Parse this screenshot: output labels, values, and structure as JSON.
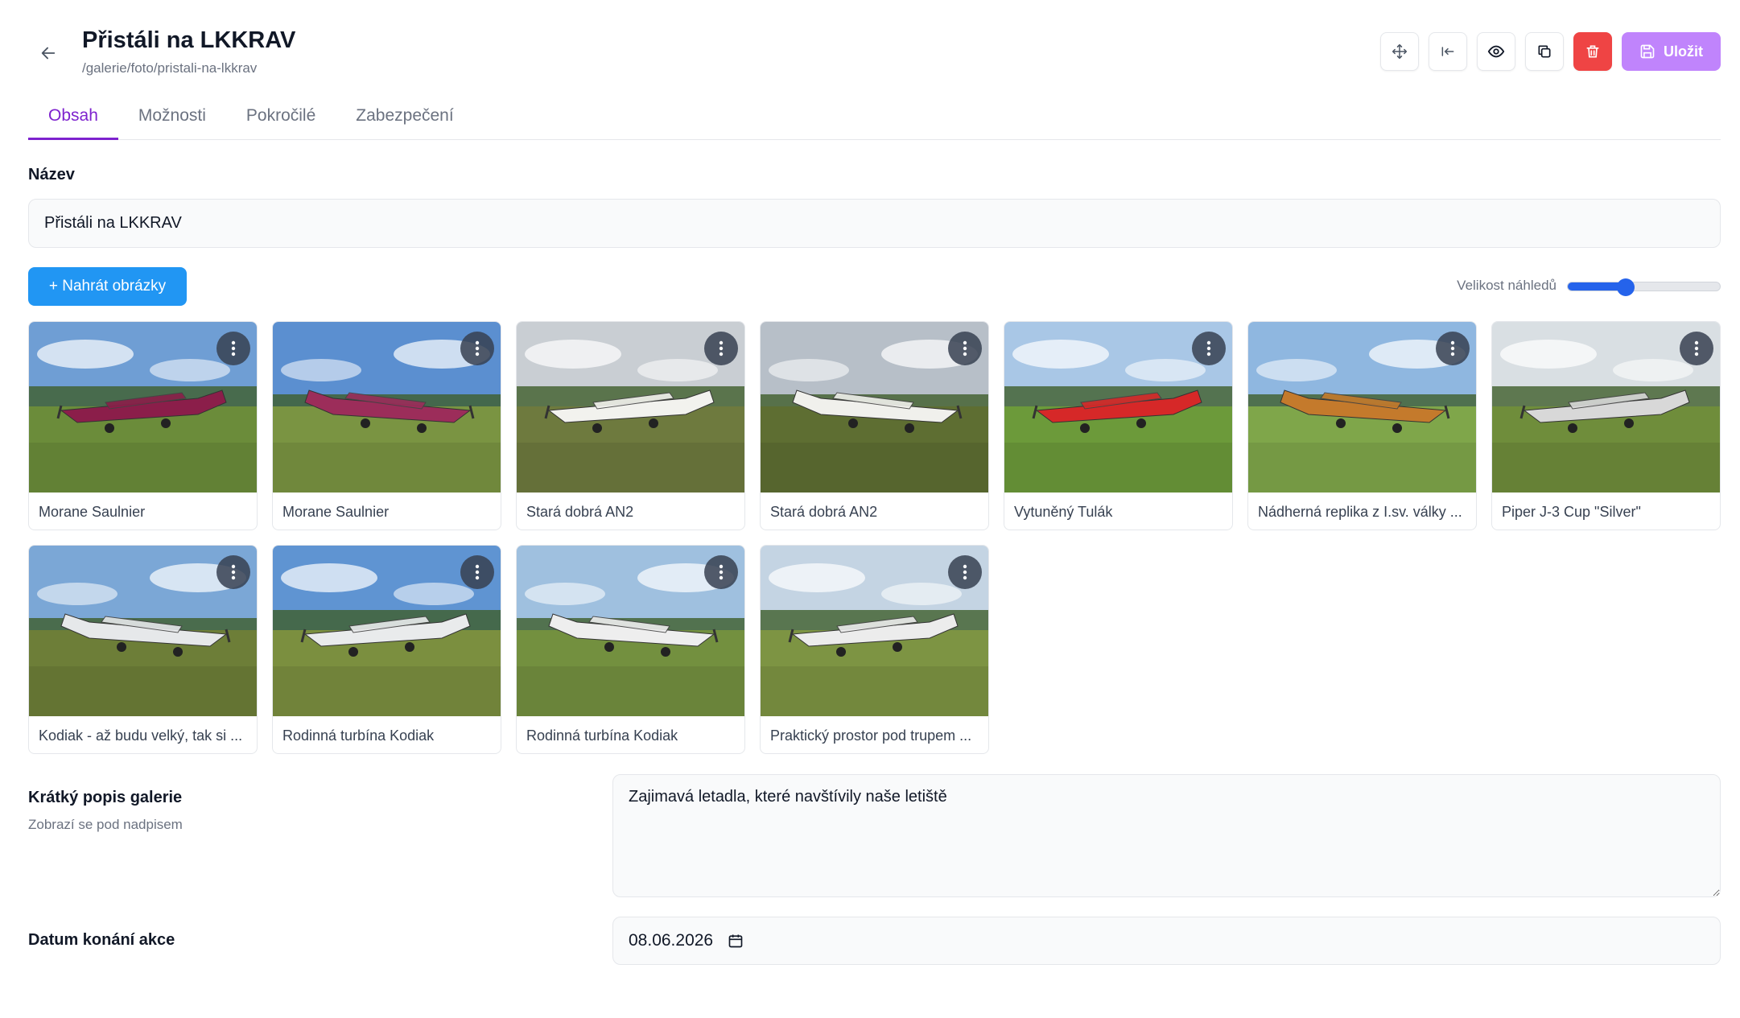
{
  "header": {
    "title": "Přistáli na LKKRAV",
    "path": "/galerie/foto/pristali-na-lkkrav",
    "save_label": "Uložit"
  },
  "tabs": [
    {
      "label": "Obsah",
      "active": true
    },
    {
      "label": "Možnosti",
      "active": false
    },
    {
      "label": "Pokročilé",
      "active": false
    },
    {
      "label": "Zabezpečení",
      "active": false
    }
  ],
  "form": {
    "name_label": "Název",
    "name_value": "Přistáli na LKKRAV",
    "upload_label": "+ Nahrát obrázky",
    "thumb_size_label": "Velikost náhledů",
    "thumb_size_value": 0.38,
    "description_label": "Krátký popis galerie",
    "description_hint": "Zobrazí se pod nadpisem",
    "description_value": "Zajimavá letadla, které navštívily naše letiště",
    "date_label": "Datum konání akce",
    "date_value": "08.06.2026"
  },
  "images": [
    {
      "caption": "Morane Saulnier",
      "sky": "#6f9ed4",
      "ground": "#6b8c3a",
      "plane": "#8b1e4a"
    },
    {
      "caption": "Morane Saulnier",
      "sky": "#5b8fd0",
      "ground": "#7a9442",
      "plane": "#9c2d5a"
    },
    {
      "caption": "Stará dobrá AN2",
      "sky": "#c9ced3",
      "ground": "#6e7a3e",
      "plane": "#f2f2ee"
    },
    {
      "caption": "Stará dobrá AN2",
      "sky": "#b7bfc8",
      "ground": "#5e6e32",
      "plane": "#f0f0ec"
    },
    {
      "caption": "Vytuněný Tulák",
      "sky": "#a9c7e6",
      "ground": "#6c9a3a",
      "plane": "#d62828"
    },
    {
      "caption": "Nádherná replika z I.sv. války ...",
      "sky": "#8fb7e0",
      "ground": "#7fa64a",
      "plane": "#c47a2c"
    },
    {
      "caption": "Piper J-3 Cup \"Silver\"",
      "sky": "#d9dfe3",
      "ground": "#6f8d3b",
      "plane": "#d8d8d8"
    },
    {
      "caption": "Kodiak - až budu velký, tak si ...",
      "sky": "#7ba7d6",
      "ground": "#6d7e38",
      "plane": "#e6e8ea"
    },
    {
      "caption": "Rodinná turbína Kodiak",
      "sky": "#5f94d2",
      "ground": "#7b8f3f",
      "plane": "#e9ebec"
    },
    {
      "caption": "Rodinná turbína Kodiak",
      "sky": "#9fc0df",
      "ground": "#73903f",
      "plane": "#eeeeee"
    },
    {
      "caption": "Praktický prostor pod trupem ...",
      "sky": "#c4d4e3",
      "ground": "#7d9443",
      "plane": "#ececec"
    }
  ]
}
